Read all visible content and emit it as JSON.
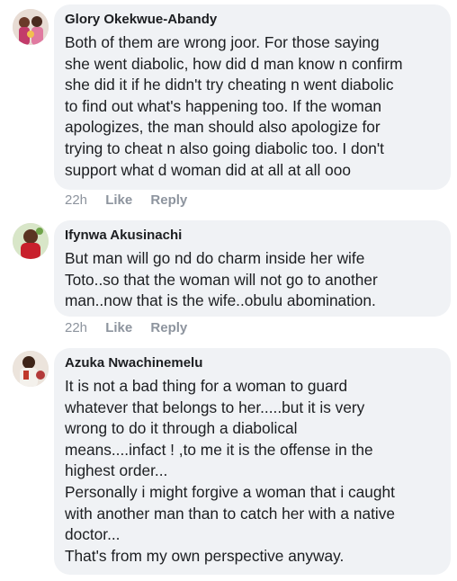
{
  "comments": [
    {
      "author": "Glory Okekwue-Abandy",
      "text": "Both of them are wrong joor. For those saying\nshe went diabolic, how did d man know n confirm\nshe did it if he didn't try cheating n went diabolic\nto find out what's happening too. If the woman\napologizes, the man should also apologize for\ntrying to cheat n also going diabolic too. I don't\nsupport what d woman did at all at all ooo",
      "time": "22h",
      "like_label": "Like",
      "reply_label": "Reply",
      "avatar_icon": "profile-photo"
    },
    {
      "author": "Ifynwa Akusinachi",
      "text": "But man will go nd do charm inside her wife\nToto..so that the woman will not go to another\nman..now that is the wife..obulu abomination.",
      "time": "22h",
      "like_label": "Like",
      "reply_label": "Reply",
      "avatar_icon": "profile-photo"
    },
    {
      "author": "Azuka Nwachinemelu",
      "text": "It is not a bad thing for a woman to guard\nwhatever that belongs to her.....but it is very\nwrong to do it through a diabolical\nmeans....infact ! ,to me it is the offense in the\nhighest order...\nPersonally i might forgive a woman that i caught\nwith another man than to catch her with a native\ndoctor...\nThat's from my own perspective anyway.",
      "avatar_icon": "profile-photo"
    }
  ],
  "colors": {
    "bubble_bg": "#f0f2f5",
    "text": "#1c1e21",
    "meta": "#8d949e"
  }
}
